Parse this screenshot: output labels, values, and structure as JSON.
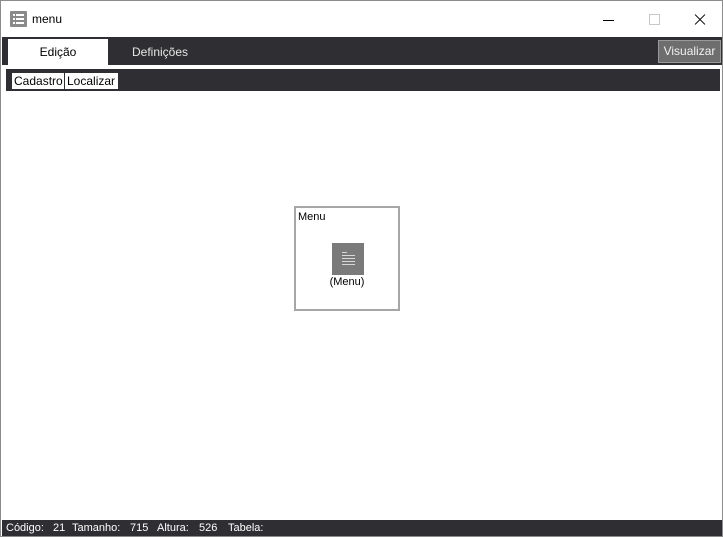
{
  "window": {
    "title": "menu",
    "icon": "list-icon"
  },
  "main_tabs": [
    {
      "label": "Edição",
      "active": true
    },
    {
      "label": "Definições",
      "active": false
    }
  ],
  "toolbar": {
    "visualizar_label": "Visualizar"
  },
  "sub_tabs": [
    {
      "label": "Cadastro",
      "active": true
    },
    {
      "label": "Localizar",
      "active": false
    }
  ],
  "menu_card": {
    "title": "Menu",
    "icon": "document-list-icon",
    "label": "(Menu)"
  },
  "status": {
    "codigo_label": "Código:",
    "codigo_value": "21",
    "tamanho_label": "Tamanho:",
    "tamanho_value": "715",
    "altura_label": "Altura:",
    "altura_value": "526",
    "tabela_label": "Tabela:",
    "tabela_value": ""
  },
  "colors": {
    "dark_bar": "#2f2f33",
    "button_gray": "#6e6e6e",
    "icon_gray": "#7a7a7a"
  }
}
